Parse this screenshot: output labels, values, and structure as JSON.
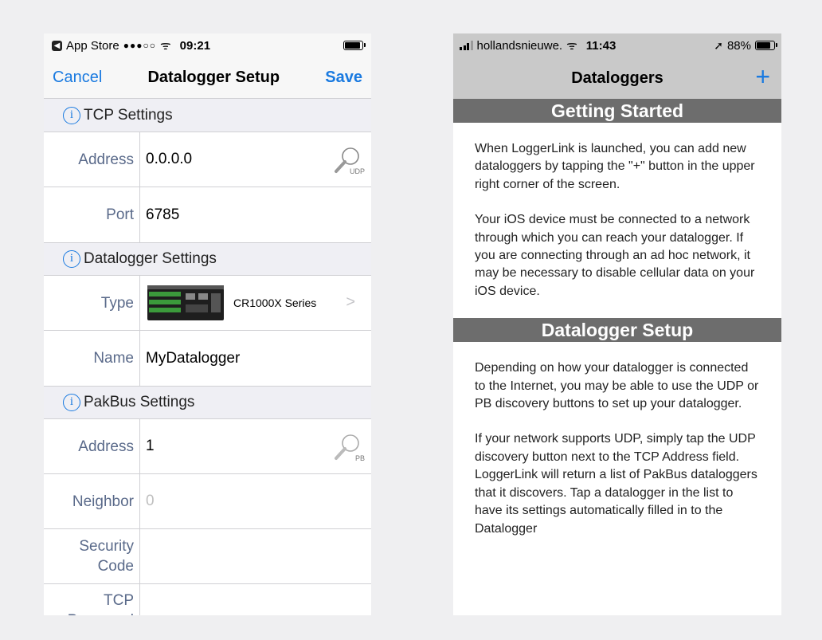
{
  "left": {
    "status": {
      "back_app": "App Store",
      "signal": "●●●○○",
      "wifi": "ᯤ",
      "time": "09:21",
      "battery_level": 1.0
    },
    "nav": {
      "cancel": "Cancel",
      "title": "Datalogger Setup",
      "save": "Save"
    },
    "tcp": {
      "header": "TCP Settings",
      "address_label": "Address",
      "address_value": "0.0.0.0",
      "address_button_tag": "UDP",
      "port_label": "Port",
      "port_value": "6785"
    },
    "datalogger": {
      "header": "Datalogger Settings",
      "type_label": "Type",
      "type_value": "CR1000X Series",
      "name_label": "Name",
      "name_value": "MyDatalogger"
    },
    "pakbus": {
      "header": "PakBus Settings",
      "address_label": "Address",
      "address_value": "1",
      "address_button_tag": "PB",
      "neighbor_label": "Neighbor",
      "neighbor_placeholder": "0",
      "security_label": "Security Code",
      "tcp_password_label": "TCP Password"
    }
  },
  "right": {
    "status": {
      "carrier": "hollandsnieuwe.",
      "time": "11:43",
      "battery_percent": "88%",
      "battery_level": 0.88
    },
    "nav": {
      "title": "Dataloggers",
      "add": "+"
    },
    "sections": [
      {
        "heading": "Getting Started",
        "paragraphs": [
          "When LoggerLink is launched, you can add new dataloggers by tapping the \"+\" button in the upper right corner of the screen.",
          "Your iOS device must be connected to a network through which you can reach your datalogger. If you are connecting through an ad hoc network, it may be necessary to disable cellular data on your iOS device."
        ]
      },
      {
        "heading": "Datalogger Setup",
        "paragraphs": [
          "Depending on how your datalogger is connected to the Internet, you may be able to use the UDP or PB discovery buttons to set up your datalogger.",
          "If your network supports UDP, simply tap the UDP discovery button next to the TCP Address field. LoggerLink will return a list of PakBus dataloggers that it discovers. Tap a datalogger in the list to have its settings automatically filled in to the Datalogger"
        ]
      }
    ]
  }
}
